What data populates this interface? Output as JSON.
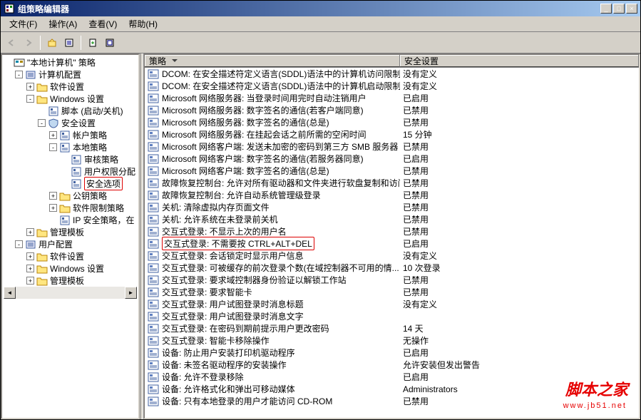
{
  "window": {
    "title": "组策略编辑器",
    "minimize": "_",
    "maximize": "□",
    "close": "×"
  },
  "menu": {
    "file": "文件(F)",
    "action": "操作(A)",
    "view": "查看(V)",
    "help": "帮助(H)"
  },
  "tree": {
    "root": "\"本地计算机\" 策略",
    "computer_config": "计算机配置",
    "software_settings": "软件设置",
    "windows_settings": "Windows 设置",
    "scripts": "脚本 (启动/关机)",
    "security_settings": "安全设置",
    "account_policies": "帐户策略",
    "local_policies": "本地策略",
    "audit_policy": "审核策略",
    "user_rights": "用户权限分配",
    "security_options": "安全选项",
    "public_key": "公钥策略",
    "software_restriction": "软件限制策略",
    "ip_security": "IP 安全策略，在",
    "admin_templates": "管理模板",
    "user_config": "用户配置",
    "software_settings2": "软件设置",
    "windows_settings2": "Windows 设置",
    "admin_templates2": "管理模板"
  },
  "list": {
    "col_policy": "策略",
    "col_setting": "安全设置",
    "rows": [
      {
        "p": "DCOM: 在安全描述符定义语言(SDDL)语法中的计算机访问限制",
        "s": "没有定义"
      },
      {
        "p": "DCOM: 在安全描述符定义语言(SDDL)语法中的计算机启动限制",
        "s": "没有定义"
      },
      {
        "p": "Microsoft 网络服务器: 当登录时间用完时自动注销用户",
        "s": "已启用"
      },
      {
        "p": "Microsoft 网络服务器: 数字签名的通信(若客户端同意)",
        "s": "已禁用"
      },
      {
        "p": "Microsoft 网络服务器: 数字签名的通信(总是)",
        "s": "已禁用"
      },
      {
        "p": "Microsoft 网络服务器: 在挂起会话之前所需的空闲时间",
        "s": "15 分钟"
      },
      {
        "p": "Microsoft 网络客户端: 发送未加密的密码到第三方 SMB 服务器",
        "s": "已禁用"
      },
      {
        "p": "Microsoft 网络客户端: 数字签名的通信(若服务器同意)",
        "s": "已启用"
      },
      {
        "p": "Microsoft 网络客户端: 数字签名的通信(总是)",
        "s": "已禁用"
      },
      {
        "p": "故障恢复控制台: 允许对所有驱动器和文件夹进行软盘复制和访问",
        "s": "已禁用"
      },
      {
        "p": "故障恢复控制台: 允许自动系统管理级登录",
        "s": "已禁用"
      },
      {
        "p": "关机: 清除虚拟内存页面文件",
        "s": "已禁用"
      },
      {
        "p": "关机: 允许系统在未登录前关机",
        "s": "已禁用"
      },
      {
        "p": "交互式登录: 不显示上次的用户名",
        "s": "已禁用"
      },
      {
        "p": "交互式登录: 不需要按 CTRL+ALT+DEL",
        "s": "已启用",
        "hl": true
      },
      {
        "p": "交互式登录: 会话锁定时显示用户信息",
        "s": "没有定义"
      },
      {
        "p": "交互式登录: 可被缓存的前次登录个数(在域控制器不可用的情...",
        "s": "10 次登录"
      },
      {
        "p": "交互式登录: 要求域控制器身份验证以解锁工作站",
        "s": "已禁用"
      },
      {
        "p": "交互式登录: 要求智能卡",
        "s": "已禁用"
      },
      {
        "p": "交互式登录: 用户试图登录时消息标题",
        "s": "没有定义"
      },
      {
        "p": "交互式登录: 用户试图登录时消息文字",
        "s": ""
      },
      {
        "p": "交互式登录: 在密码到期前提示用户更改密码",
        "s": "14 天"
      },
      {
        "p": "交互式登录: 智能卡移除操作",
        "s": "无操作"
      },
      {
        "p": "设备: 防止用户安装打印机驱动程序",
        "s": "已启用"
      },
      {
        "p": "设备: 未签名驱动程序的安装操作",
        "s": "允许安装但发出警告"
      },
      {
        "p": "设备: 允许不登录移除",
        "s": "已启用"
      },
      {
        "p": "设备: 允许格式化和弹出可移动媒体",
        "s": "Administrators"
      },
      {
        "p": "设备: 只有本地登录的用户才能访问 CD-ROM",
        "s": "已禁用"
      }
    ]
  },
  "watermark": {
    "text": "脚本之家",
    "url": "www.jb51.net"
  }
}
